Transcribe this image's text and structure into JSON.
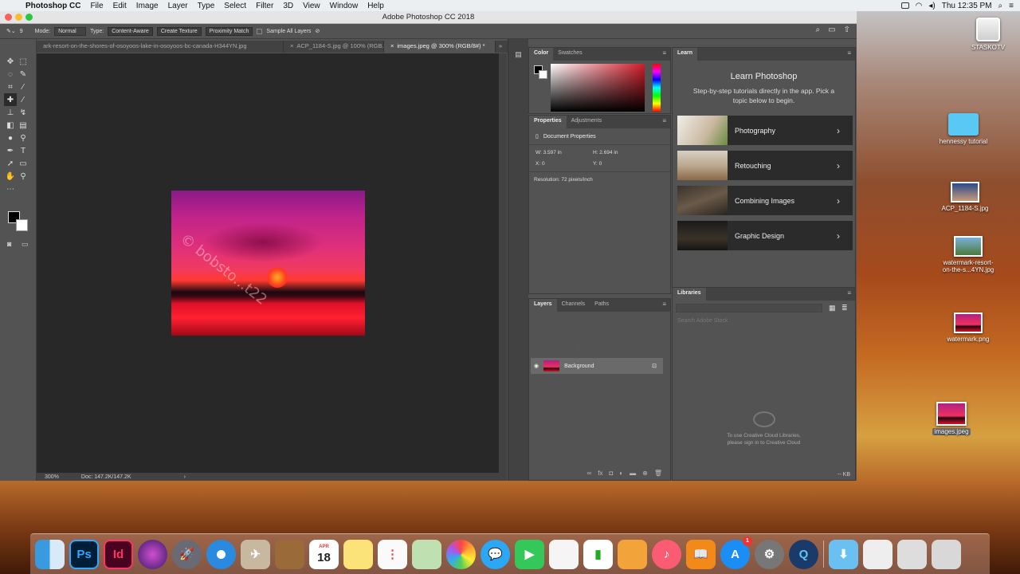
{
  "menubar": {
    "app": "Photoshop CC",
    "items": [
      "File",
      "Edit",
      "Image",
      "Layer",
      "Type",
      "Select",
      "Filter",
      "3D",
      "View",
      "Window",
      "Help"
    ],
    "clock": "Thu 12:35 PM"
  },
  "window": {
    "title": "Adobe Photoshop CC 2018"
  },
  "options": {
    "mode_label": "Mode:",
    "mode_value": "Normal",
    "type_label": "Type:",
    "type_btns": [
      "Content-Aware",
      "Create Texture",
      "Proximity Match"
    ],
    "sample_all": "Sample All Layers",
    "brush_size": "9"
  },
  "tabs": [
    {
      "label": "ark-resort-on-the-shores-of-osoyoos-lake-in-osoyoos-bc-canada-H344YN.jpg",
      "active": false
    },
    {
      "label": "ACP_1184-S.jpg @ 100% (RGB...",
      "active": false
    },
    {
      "label": "images.jpeg @ 300% (RGB/8#) *",
      "active": true
    }
  ],
  "canvas": {
    "watermark": "© bobsto...t22"
  },
  "status": {
    "zoom": "300%",
    "doc": "Doc: 147.2K/147.2K",
    "arrow": "›"
  },
  "color_panel": {
    "tabs": [
      "Color",
      "Swatches"
    ]
  },
  "properties": {
    "tabs": [
      "Properties",
      "Adjustments"
    ],
    "title": "Document Properties",
    "w": "W:  3.597 in",
    "h": "H:  2.694 in",
    "x": "X:  0",
    "y": "Y:  0",
    "resolution": "Resolution: 72 pixels/inch"
  },
  "layers": {
    "tabs": [
      "Layers",
      "Channels",
      "Paths"
    ],
    "kind": "Kind",
    "mode": "Normal",
    "opacity": "Opacity:",
    "opacity_val": "100%",
    "lock": "Lock:",
    "fill": "Fill:",
    "fill_val": "100%",
    "layer_name": "Background"
  },
  "learn": {
    "tab": "Learn",
    "title": "Learn Photoshop",
    "desc": "Step-by-step tutorials directly in the app. Pick a topic below to begin.",
    "topics": [
      "Photography",
      "Retouching",
      "Combining Images",
      "Graphic Design"
    ]
  },
  "libraries": {
    "tab": "Libraries",
    "search": "Search Adobe Stock",
    "msg1": "To use Creative Cloud Libraries,",
    "msg2": "please sign in to Creative Cloud",
    "kb": "-- KB"
  },
  "desktop": {
    "icons": [
      "STASKOTV",
      "hennessy tutorial",
      "ACP_1184-S.jpg",
      "watermark-resort-",
      "on-the-s...4YN.jpg",
      "watermark.png",
      "images.jpeg"
    ]
  },
  "dock": {
    "calendar_month": "APR",
    "calendar_day": "18",
    "appstore_badge": "1"
  }
}
